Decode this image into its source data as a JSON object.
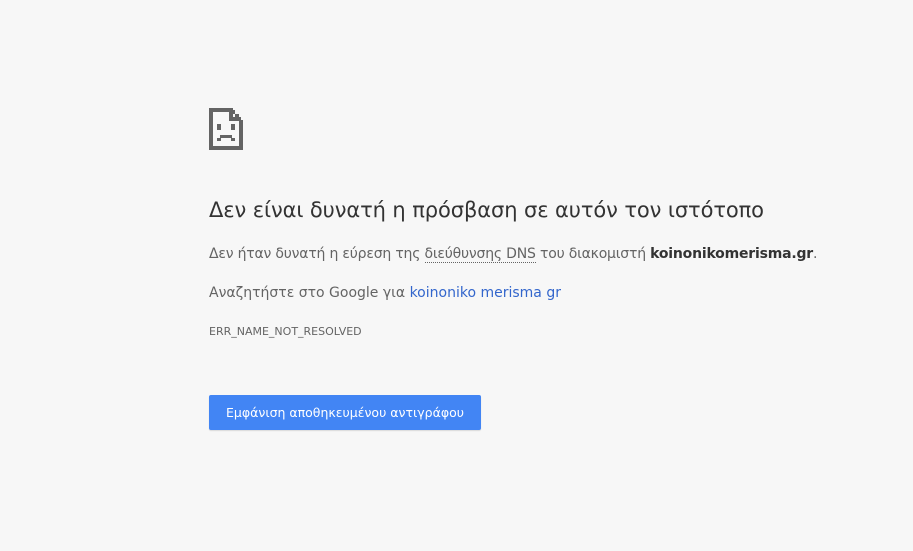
{
  "error_page": {
    "icon": "sad-document-icon",
    "title": "Δεν είναι δυνατή η πρόσβαση σε αυτόν τον ιστότοπο",
    "details": {
      "prefix": "Δεν ήταν δυνατή η εύρεση της ",
      "dns_term": "διεύθυνσης DNS",
      "middle": " του διακομιστή ",
      "host": "koinonikomerisma.gr",
      "suffix": "."
    },
    "search": {
      "prefix": "Αναζητήστε στο Google για ",
      "link_text": "koinoniko merisma gr"
    },
    "error_code": "ERR_NAME_NOT_RESOLVED",
    "cached_copy_button": "Εμφάνιση αποθηκευμένου αντιγράφου"
  },
  "colors": {
    "background": "#f7f7f7",
    "title": "#333333",
    "text": "#646464",
    "link": "#3366cc",
    "button": "#4285f4",
    "button_text": "#ffffff"
  }
}
